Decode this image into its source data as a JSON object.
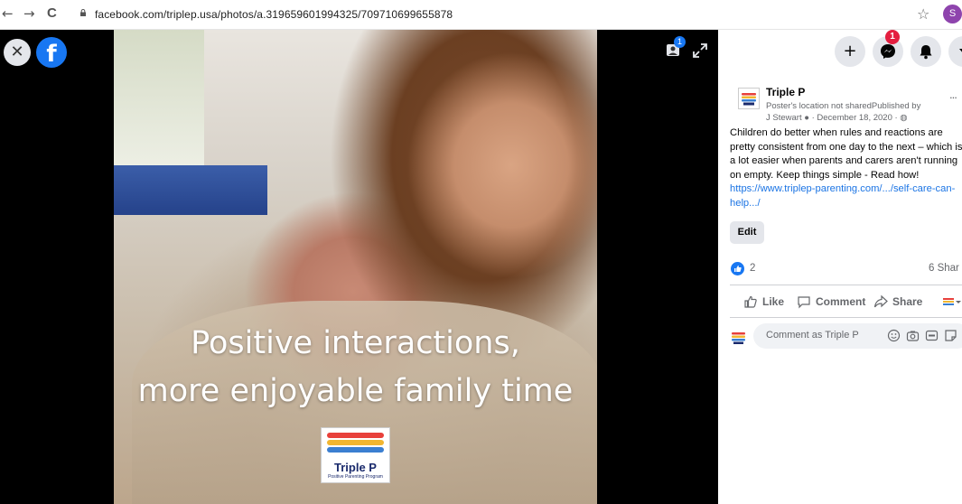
{
  "browser": {
    "back_glyph": "←",
    "forward_glyph": "→",
    "reload_glyph": "C",
    "url": "facebook.com/triplep.usa/photos/a.319659601994325/709710699655878",
    "star_glyph": "☆",
    "profile_initial": "S"
  },
  "viewer": {
    "close_glyph": "✕",
    "fb_logo_letter": "f",
    "tag_badge_count": "1",
    "caption_line_1": "Positive interactions,",
    "caption_line_2": "more enjoyable family time",
    "brand_name": "Triple P",
    "brand_tagline": "Positive Parenting Program",
    "brand_colors": [
      "#e8403a",
      "#f2b631",
      "#3b7fd1",
      "#1a2a6c"
    ]
  },
  "top_actions": {
    "plus_glyph": "+",
    "messenger_badge": "1",
    "icons": [
      "plus-icon",
      "messenger-icon",
      "notifications-icon",
      "account-menu-icon"
    ]
  },
  "post": {
    "author": "Triple P",
    "meta_line_1": "Poster's location not sharedPublished by",
    "meta_line_2": "J Stewart ● · December 18, 2020 · ◍",
    "more_label": "...",
    "text": "Children do better when rules and reactions are pretty consistent from one day to the next – which is a lot easier when parents and carers aren't running on empty. Keep things simple - Read how! ",
    "link_text": "https://www.triplep-parenting.com/.../self-care-can-help.../",
    "edit_label": "Edit",
    "like_count": "2",
    "share_count": "6 Shar",
    "actions": {
      "like": "Like",
      "comment": "Comment",
      "share": "Share"
    },
    "comment_placeholder": "Comment as Triple P"
  },
  "colors": {
    "facebook_blue": "#1877f2",
    "badge_red": "#e41e3f",
    "link_blue": "#1b74e4"
  }
}
